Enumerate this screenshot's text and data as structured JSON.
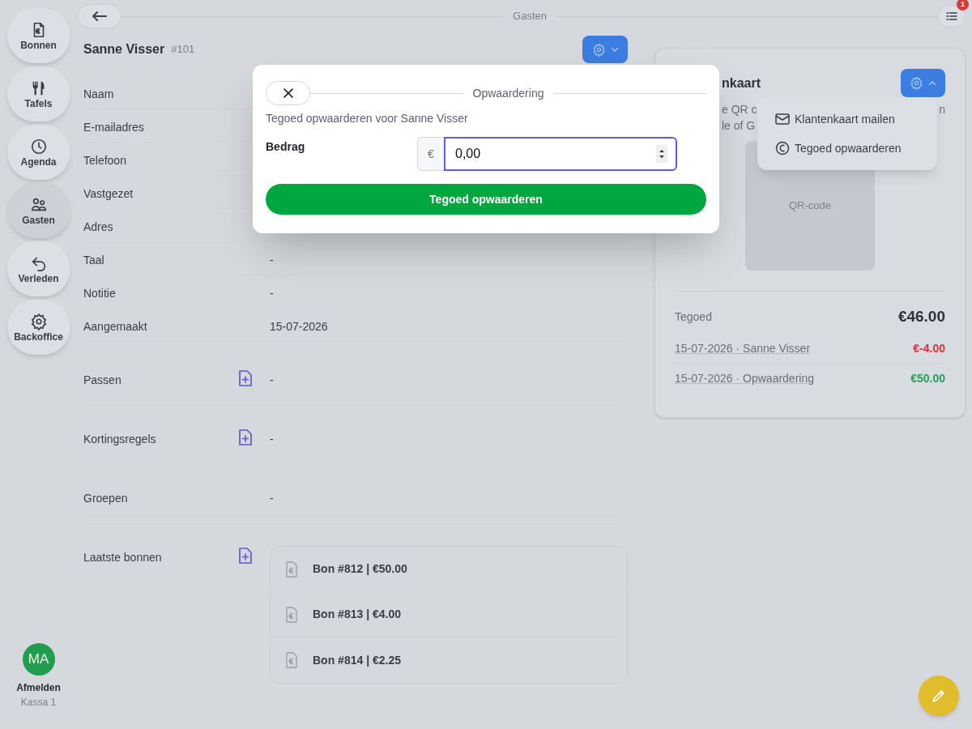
{
  "sidebar": {
    "items": [
      {
        "label": "Bonnen",
        "selected": false
      },
      {
        "label": "Tafels",
        "selected": false
      },
      {
        "label": "Agenda",
        "selected": false
      },
      {
        "label": "Gasten",
        "selected": true
      },
      {
        "label": "Verleden",
        "selected": false
      },
      {
        "label": "Backoffice",
        "selected": false
      }
    ]
  },
  "user": {
    "initials": "MA",
    "action": "Afmelden",
    "register": "Kassa 1"
  },
  "top_bar": {
    "title": "Gasten",
    "notification_count": "1"
  },
  "guest": {
    "name": "Sanne Visser",
    "number": "#101"
  },
  "fields": [
    {
      "label": "Naam",
      "addable": false
    },
    {
      "label": "E-mailadres",
      "addable": false
    },
    {
      "label": "Telefoon",
      "addable": false
    },
    {
      "label": "Vastgezet",
      "addable": false
    },
    {
      "label": "Adres",
      "addable": false
    },
    {
      "label": "Taal",
      "value": "-",
      "addable": false
    },
    {
      "label": "Notitie",
      "value": "-",
      "addable": false
    },
    {
      "label": "Aangemaakt",
      "value": "15-07-2026",
      "addable": false
    },
    {
      "label": "Passen",
      "value": "-",
      "addable": true
    },
    {
      "label": "Kortingsregels",
      "value": "-",
      "addable": true
    },
    {
      "label": "Groepen",
      "value": "-",
      "addable": false
    },
    {
      "label": "Laatste bonnen",
      "addable": true,
      "receipts": [
        "Bon #812 | €50.00",
        "Bon #813 | €4.00",
        "Bon #814 | €2.25"
      ]
    }
  ],
  "card": {
    "title_visible": "nkaart",
    "description_visible": [
      [
        "e QR c",
        "n"
      ],
      [
        "le of G"
      ]
    ],
    "qr_label": "QR-code",
    "balance_label": "Tegoed",
    "balance": "€46.00",
    "transactions": [
      {
        "text": "15-07-2026 · Sanne Visser",
        "amount": "€-4.00",
        "kind": "debit"
      },
      {
        "text": "15-07-2026 · Opwaardering",
        "amount": "€50.00",
        "kind": "credit"
      }
    ],
    "menu": {
      "open": true,
      "items": [
        {
          "label": "Klantenkaart mailen",
          "kind": "mail"
        },
        {
          "label": "Tegoed opwaarderen",
          "kind": "euro"
        }
      ]
    }
  },
  "modal": {
    "title": "Opwaardering",
    "subtitle": "Tegoed opwaarderen voor Sanne Visser",
    "amount_label": "Bedrag",
    "currency": "€",
    "amount": "0,00",
    "submit": "Tegoed opwaarderen"
  }
}
